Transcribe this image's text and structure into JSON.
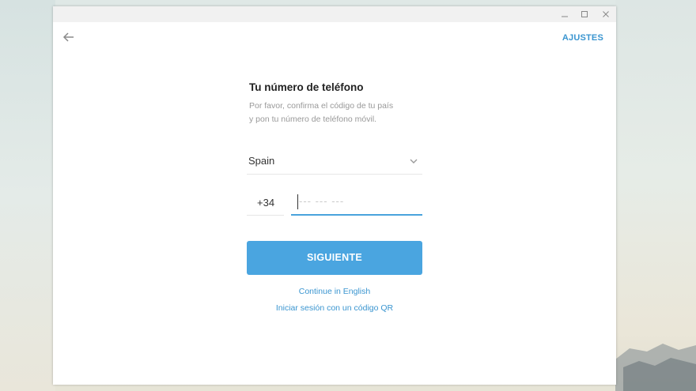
{
  "window": {
    "controls": {
      "minimize": "minimize-icon",
      "maximize": "maximize-icon",
      "close": "close-icon"
    }
  },
  "header": {
    "back_icon": "arrow-left-icon",
    "settings_label": "AJUSTES"
  },
  "form": {
    "title": "Tu número de teléfono",
    "description_line1": "Por favor, confirma el código de tu país",
    "description_line2": "y pon tu número de teléfono móvil.",
    "country": "Spain",
    "country_code": "+34",
    "phone_placeholder": "--- --- ---",
    "phone_value": "",
    "next_label": "SIGUIENTE"
  },
  "links": {
    "english": "Continue in English",
    "qr": "Iniciar sesión con un código QR"
  },
  "colors": {
    "accent": "#4aa5e0",
    "link": "#3a95d0"
  }
}
